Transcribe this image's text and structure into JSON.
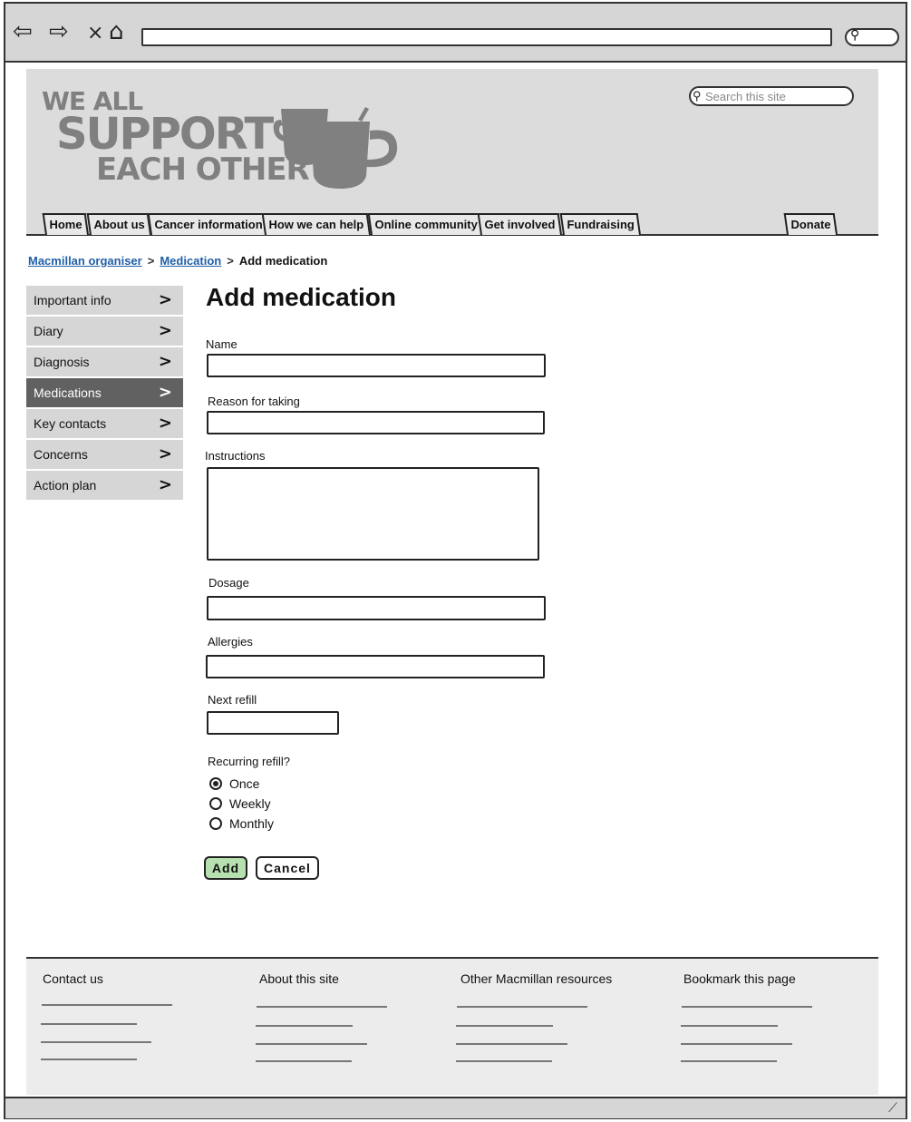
{
  "browser": {
    "back_icon": "⇦",
    "forward_icon": "⇨",
    "stop_icon": "×",
    "home_icon": "⌂",
    "search_icon": "🔍︎"
  },
  "header": {
    "logo_line1": "WE ALL",
    "logo_line2": "SUPPORT",
    "logo_line3": "EACH OTHER",
    "search_placeholder": "Search this site",
    "tabs": [
      {
        "label": "Home"
      },
      {
        "label": "About us"
      },
      {
        "label": "Cancer information"
      },
      {
        "label": "How we can help"
      },
      {
        "label": "Online community"
      },
      {
        "label": "Get involved"
      },
      {
        "label": "Fundraising"
      }
    ],
    "donate_label": "Donate"
  },
  "breadcrumb": {
    "items": [
      "Macmillan organiser",
      "Medication"
    ],
    "current": "Add medication",
    "separator": ">"
  },
  "sidebar": {
    "items": [
      {
        "label": "Important info"
      },
      {
        "label": "Diary"
      },
      {
        "label": "Diagnosis"
      },
      {
        "label": "Medications",
        "active": true
      },
      {
        "label": "Key contacts"
      },
      {
        "label": "Concerns"
      },
      {
        "label": "Action plan"
      }
    ],
    "chevron": ">"
  },
  "form": {
    "title": "Add medication",
    "fields": {
      "name": {
        "label": "Name",
        "value": ""
      },
      "reason": {
        "label": "Reason for taking",
        "value": ""
      },
      "instructions": {
        "label": "Instructions",
        "value": ""
      },
      "dosage": {
        "label": "Dosage",
        "value": ""
      },
      "allergies": {
        "label": "Allergies",
        "value": ""
      },
      "next_refill": {
        "label": "Next refill",
        "value": ""
      }
    },
    "recurring": {
      "label": "Recurring refill?",
      "options": [
        "Once",
        "Weekly",
        "Monthly"
      ],
      "selected": "Once"
    },
    "add_label": "Add",
    "cancel_label": "Cancel",
    "add_color": "#b7e0b0"
  },
  "footer": {
    "columns": [
      {
        "heading": "Contact us"
      },
      {
        "heading": "About this site"
      },
      {
        "heading": "Other Macmillan resources"
      },
      {
        "heading": "Bookmark this page"
      }
    ]
  },
  "colors": {
    "header_bg": "#dcdcdc",
    "active_nav": "#616161",
    "link": "#1f5fa8"
  }
}
